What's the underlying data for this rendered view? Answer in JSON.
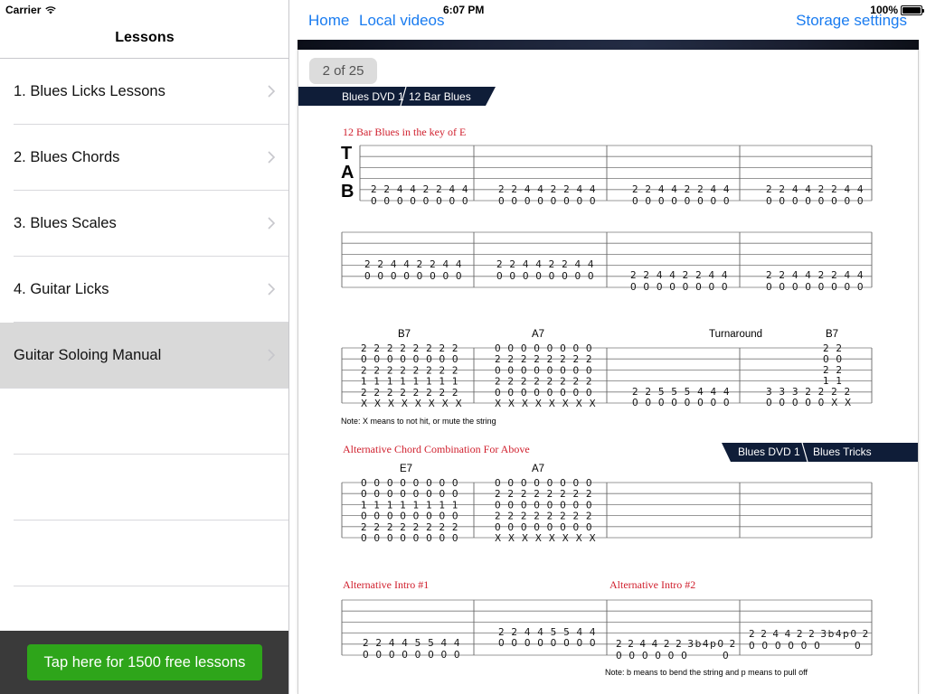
{
  "status": {
    "carrier": "Carrier",
    "time": "6:07 PM",
    "battery": "100%"
  },
  "left": {
    "title": "Lessons",
    "items": [
      {
        "label": "1. Blues Licks Lessons"
      },
      {
        "label": "2. Blues Chords"
      },
      {
        "label": "3. Blues Scales"
      },
      {
        "label": "4. Guitar Licks"
      },
      {
        "label": "Guitar Soloing Manual",
        "selected": true
      }
    ],
    "promo_label": "Tap here for 1500 free lessons"
  },
  "nav": {
    "home": "Home",
    "local": "Local videos",
    "storage": "Storage settings"
  },
  "page_counter": "2 of 25",
  "sheet": {
    "banner1": {
      "left": "Blues DVD 1",
      "right": "12 Bar Blues"
    },
    "banner2": {
      "left": "Blues DVD 1",
      "right": "Blues Tricks"
    },
    "tab_letters": [
      "T",
      "A",
      "B"
    ],
    "s1_title": "12 Bar Blues in the key of E",
    "s1_rows": [
      [
        "2 2 4 4 2 2 4 4",
        "2 2 4 4 2 2 4 4",
        "2 2 4 4 2 2 4 4",
        "2 2 4 4 2 2 4 4"
      ],
      [
        "0 0 0 0 0 0 0 0",
        "0 0 0 0 0 0 0 0",
        "0 0 0 0 0 0 0 0",
        "0 0 0 0 0 0 0 0"
      ]
    ],
    "s2_rows": [
      [
        "2 2 4 4 2 2 4 4",
        "2 2 4 4 2 2 4 4",
        "2 2 4 4 2 2 4 4",
        "2 2 4 4 2 2 4 4"
      ],
      [
        "0 0 0 0 0 0 0 0",
        "0 0 0 0 0 0 0 0",
        "0 0 0 0 0 0 0 0",
        "0 0 0 0 0 0 0 0"
      ]
    ],
    "s3_labels": [
      "B7",
      "A7",
      "Turnaround",
      "B7"
    ],
    "s3_m1": [
      "2 2 2 2 2 2 2 2",
      "0 0 0 0 0 0 0 0",
      "2 2 2 2 2 2 2 2",
      "1 1 1 1 1 1 1 1",
      "2 2 2 2 2 2 2 2",
      "X X X X X X X X"
    ],
    "s3_m2": [
      "0 0 0 0 0 0 0 0",
      "2 2 2 2 2 2 2 2",
      "0 0 0 0 0 0 0 0",
      "2 2 2 2 2 2 2 2",
      "0 0 0 0 0 0 0 0",
      "X X X X X X X X"
    ],
    "s3_m3": [
      "2 2 5 5 5 4 4 4",
      "0 0 0 0 0 0 0 0"
    ],
    "s3_m4_chord": [
      "2 2",
      "0 0",
      "2 2",
      "1 1"
    ],
    "s3_m4_low": [
      "3 3 3 2 2 2 2",
      "0 0 0 0 0 X X"
    ],
    "note1": "Note: X means to not hit, or mute the string",
    "s4_title": "Alternative Chord Combination For Above",
    "s4_labels": [
      "E7",
      "A7"
    ],
    "s4_m1": [
      "0 0 0 0 0 0 0 0",
      "0 0 0 0 0 0 0 0",
      "1 1 1 1 1 1 1 1",
      "0 0 0 0 0 0 0 0",
      "2 2 2 2 2 2 2 2",
      "0 0 0 0 0 0 0 0"
    ],
    "s4_m2": [
      "0 0 0 0 0 0 0 0",
      "2 2 2 2 2 2 2 2",
      "0 0 0 0 0 0 0 0",
      "2 2 2 2 2 2 2 2",
      "0 0 0 0 0 0 0 0",
      "X X X X X X X X"
    ],
    "s5_title1": "Alternative Intro #1",
    "s5_title2": "Alternative Intro #2",
    "s5_m1": [
      "2 2 4 4 5 5 4 4",
      "0 0 0 0 0 0 0 0"
    ],
    "s5_m2": [
      "2 2 4 4 5 5 4 4",
      "0 0 0 0 0 0 0 0"
    ],
    "s5_m3": [
      "2 2 4 4 2 2 3b4p0 2",
      "0 0 0 0 0 0",
      "0"
    ],
    "s5_m4": [
      "2 2 4 4 2 2 3b4p0 2",
      "0 0 0 0 0 0",
      "0"
    ],
    "note2": "Note: b means to bend the string and p means to pull off"
  },
  "colors": {
    "accent_red": "#d0202e",
    "banner_navy": "#0f1d38",
    "link_blue": "#1a7cf0",
    "promo_green": "#2ea51a"
  }
}
